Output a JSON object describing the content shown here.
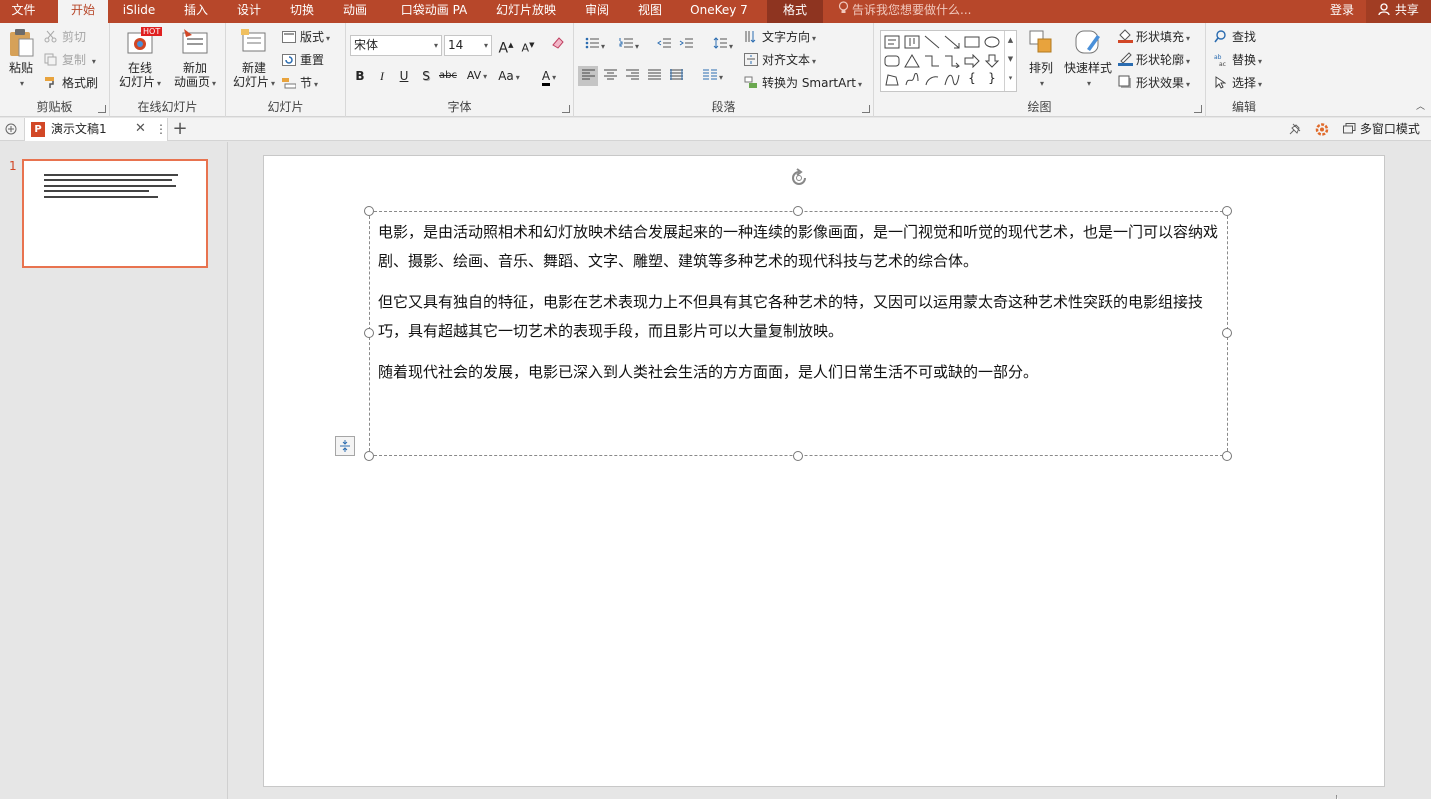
{
  "tabs": [
    {
      "label": "文件",
      "state": "normal"
    },
    {
      "label": "开始",
      "state": "active"
    },
    {
      "label": "iSlide",
      "state": "normal"
    },
    {
      "label": "插入",
      "state": "normal"
    },
    {
      "label": "设计",
      "state": "normal"
    },
    {
      "label": "切换",
      "state": "normal"
    },
    {
      "label": "动画",
      "state": "normal"
    },
    {
      "label": "口袋动画 PA",
      "state": "normal"
    },
    {
      "label": "幻灯片放映",
      "state": "normal"
    },
    {
      "label": "审阅",
      "state": "normal"
    },
    {
      "label": "视图",
      "state": "normal"
    },
    {
      "label": "OneKey 7",
      "state": "normal"
    },
    {
      "label": "格式",
      "state": "context"
    }
  ],
  "tell_me": "告诉我您想要做什么...",
  "login": "登录",
  "share": "共享",
  "ribbon": {
    "clipboard": {
      "label": "剪贴板",
      "paste": "粘贴",
      "cut": "剪切",
      "copy": "复制",
      "format_painter": "格式刷"
    },
    "online_slides": {
      "label": "在线幻灯片",
      "online_line1": "在线",
      "online_line2": "幻灯片",
      "hot_badge": "HOT",
      "new_anim_line1": "新加",
      "new_anim_line2": "动画页"
    },
    "slides": {
      "label": "幻灯片",
      "new_line1": "新建",
      "new_line2": "幻灯片",
      "layout": "版式",
      "reset": "重置",
      "section": "节"
    },
    "font": {
      "label": "字体",
      "font_name": "宋体",
      "font_size": "14",
      "grow": "A",
      "shrink": "A",
      "bold": "B",
      "italic": "I",
      "underline": "U",
      "shadow": "S",
      "strike": "abc",
      "spacing": "AV",
      "case": "Aa",
      "color": "A"
    },
    "paragraph": {
      "label": "段落",
      "text_direction": "文字方向",
      "align_text": "对齐文本",
      "smartart": "转换为 SmartArt"
    },
    "drawing": {
      "label": "绘图",
      "arrange": "排列",
      "quick_styles": "快速样式",
      "shape_fill": "形状填充",
      "shape_outline": "形状轮廓",
      "shape_effects": "形状效果"
    },
    "editing": {
      "label": "编辑",
      "find": "查找",
      "replace": "替换",
      "select": "选择"
    }
  },
  "document": {
    "tab_title": "演示文稿1",
    "multi_window": "多窗口模式"
  },
  "colors": {
    "accent": "#b7472a",
    "context_tab": "#8e3420",
    "thumb_border": "#e8734f"
  },
  "slides_pane": {
    "slide_number": "1"
  },
  "slide": {
    "paragraphs": [
      "电影，是由活动照相术和幻灯放映术结合发展起来的一种连续的影像画面，是一门视觉和听觉的现代艺术，也是一门可以容纳戏剧、摄影、绘画、音乐、舞蹈、文字、雕塑、建筑等多种艺术的现代科技与艺术的综合体。",
      "但它又具有独自的特征，电影在艺术表现力上不但具有其它各种艺术的特，又因可以运用蒙太奇这种艺术性突跃的电影组接技巧，具有超越其它一切艺术的表现手段，而且影片可以大量复制放映。",
      "随着现代社会的发展，电影已深入到人类社会生活的方方面面，是人们日常生活不可或缺的一部分。"
    ]
  }
}
